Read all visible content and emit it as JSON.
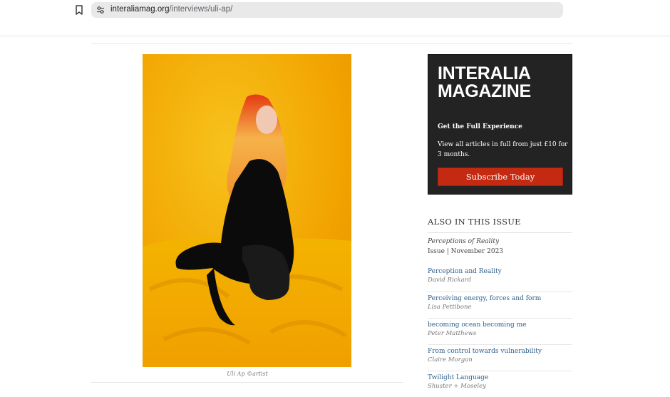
{
  "browser": {
    "url_host": "interaliamag.org",
    "url_path": "/interviews/uli-ap/"
  },
  "photo": {
    "caption": "Uli Ap ©artist"
  },
  "promo": {
    "title_line1": "INTERALIA",
    "title_line2": "MAGAZINE",
    "heading": "Get the Full Experience",
    "text": "View all articles in full from just £10 for 3 months.",
    "button_label": "Subscribe Today",
    "colors": {
      "background": "#232323",
      "button": "#c42a12"
    }
  },
  "also": {
    "heading": "ALSO IN THIS ISSUE",
    "issue_title": "Perceptions of Reality",
    "issue_date": "Issue | November 2023",
    "articles": [
      {
        "title": "Perception and Reality",
        "author": "David Rickard"
      },
      {
        "title": "Perceiving energy, forces and form",
        "author": "Lisa Pettibone"
      },
      {
        "title": "becoming ocean becoming me",
        "author": "Peter Matthews"
      },
      {
        "title": "From control towards vulnerability",
        "author": "Claire Morgan"
      },
      {
        "title": "Twilight Language",
        "author": "Shuster + Moseley"
      }
    ]
  },
  "icons": [
    "bookmark-icon",
    "site-settings-icon"
  ],
  "colors": {
    "link": "#2e5f8c",
    "photo_backdrop": "#f4a900"
  }
}
